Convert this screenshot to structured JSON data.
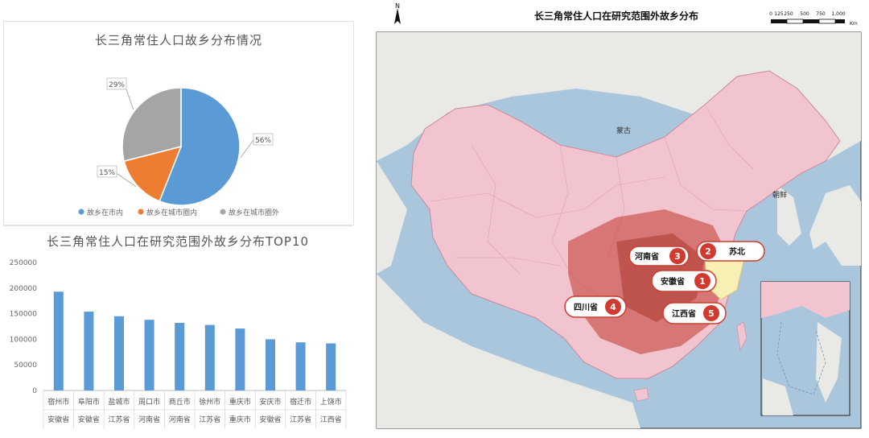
{
  "chart_data": [
    {
      "type": "pie",
      "title": "长三角常住人口故乡分布情况",
      "slices": [
        {
          "name": "故乡在市内",
          "value": 56,
          "label": "56%",
          "color": "#5b9bd5"
        },
        {
          "name": "故乡在城市圈内",
          "value": 15,
          "label": "15%",
          "color": "#ed7d31"
        },
        {
          "name": "故乡在城市圈外",
          "value": 29,
          "label": "29%",
          "color": "#a5a5a5"
        }
      ],
      "legend_position": "bottom"
    },
    {
      "type": "bar",
      "title": "长三角常住人口在研究范围外故乡分布TOP10",
      "categories": [
        [
          "宿州市",
          "安徽省"
        ],
        [
          "阜阳市",
          "安徽省"
        ],
        [
          "盐城市",
          "江苏省"
        ],
        [
          "周口市",
          "河南省"
        ],
        [
          "商丘市",
          "河南省"
        ],
        [
          "徐州市",
          "江苏省"
        ],
        [
          "重庆市",
          "重庆市"
        ],
        [
          "安庆市",
          "安徽省"
        ],
        [
          "宿迁市",
          "江苏省"
        ],
        [
          "上饶市",
          "江西省"
        ]
      ],
      "values": [
        193000,
        154000,
        145000,
        138000,
        132000,
        128000,
        121000,
        100000,
        94000,
        92000
      ],
      "ylim": [
        0,
        250000
      ],
      "yticks": [
        0,
        50000,
        100000,
        150000,
        200000,
        250000
      ],
      "ytick_labels": [
        "0",
        "50000",
        "100000",
        "150000",
        "200000",
        "250000"
      ],
      "color": "#5b9bd5",
      "grid": false
    }
  ],
  "map": {
    "title": "长三角常住人口在研究范围外故乡分布",
    "north_label": "N",
    "scale_ticks": [
      "0",
      "125",
      "250",
      "500",
      "750",
      "1,000"
    ],
    "scale_unit": "Km",
    "places": {
      "mongolia": "蒙古",
      "korea": "朝鲜"
    },
    "callouts": [
      {
        "rank": "1",
        "label": "安徽省"
      },
      {
        "rank": "2",
        "label": "苏北"
      },
      {
        "rank": "3",
        "label": "河南省"
      },
      {
        "rank": "4",
        "label": "四川省"
      },
      {
        "rank": "5",
        "label": "江西省"
      }
    ],
    "colors": {
      "region_fill": "#f2c4cf",
      "hot_fill": "#c0392b",
      "sea": "#a9c6dd",
      "land_bg": "#e9e9e6",
      "callout_red": "#d13b2f",
      "yrd": "#f8f0b4"
    }
  }
}
